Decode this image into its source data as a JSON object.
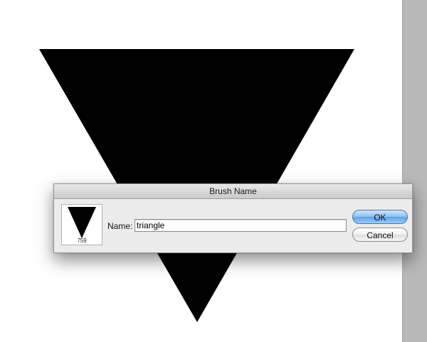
{
  "dialog": {
    "title": "Brush Name",
    "name_label": "Name:",
    "name_value": "triangle",
    "brush_size": "759",
    "ok_label": "OK",
    "cancel_label": "Cancel"
  },
  "colors": {
    "shape_fill": "#000000",
    "canvas": "#ffffff",
    "gutter": "#b9b9b9",
    "default_button": "#7ab6ee"
  },
  "icons": {
    "brush_preview": "inverted-triangle-icon"
  }
}
